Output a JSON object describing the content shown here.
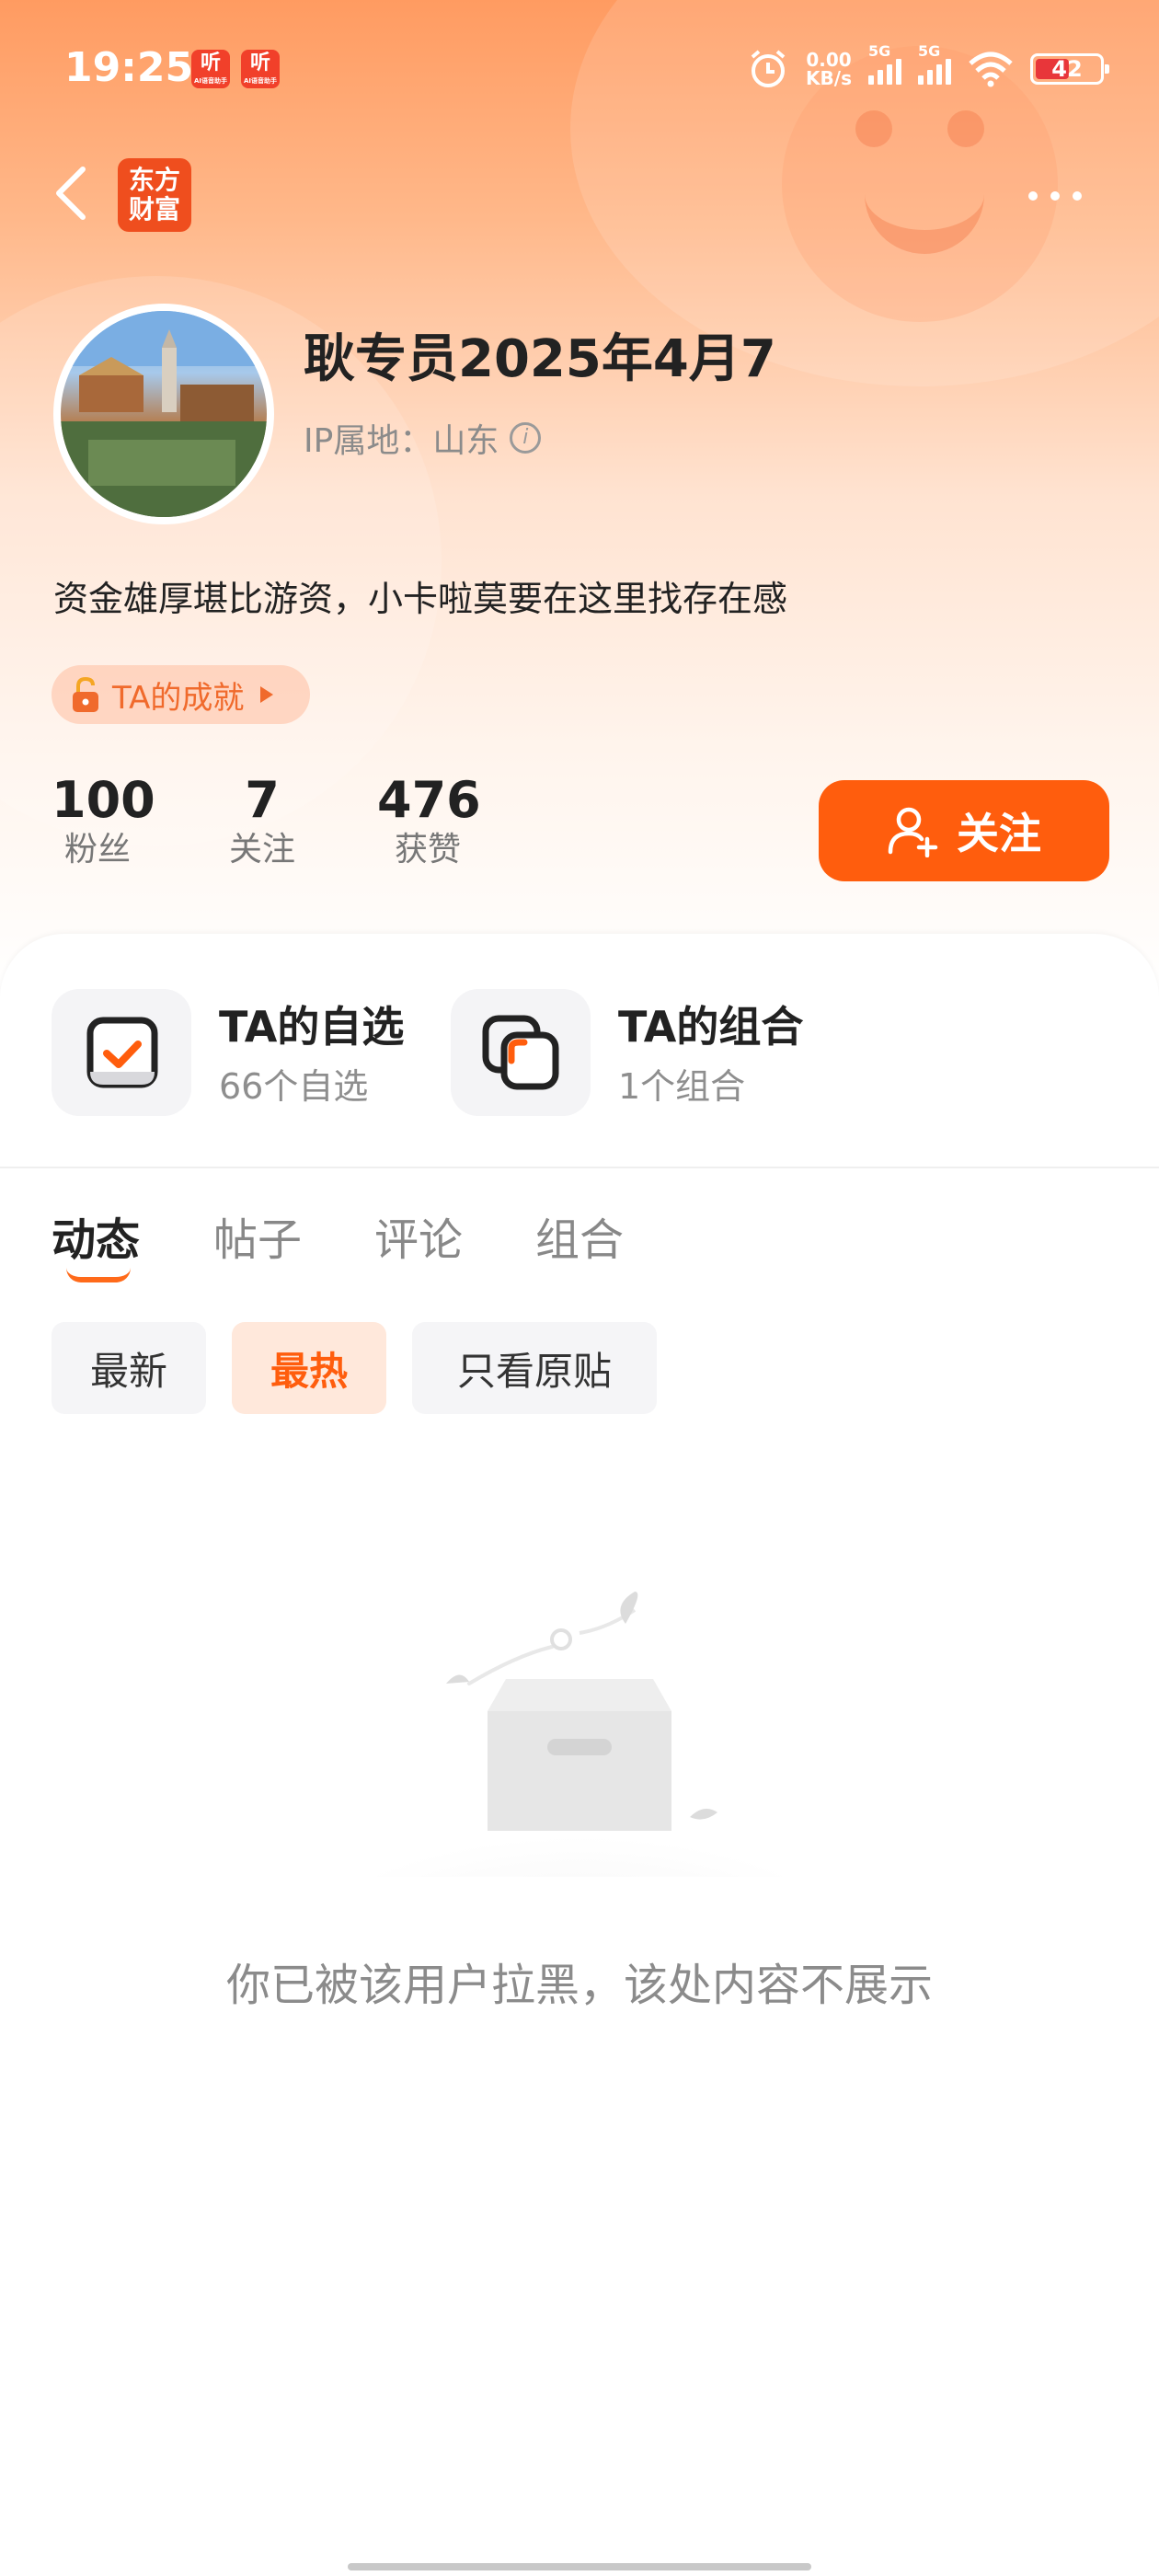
{
  "status_bar": {
    "time": "19:25",
    "app_badges": [
      {
        "glyph": "听",
        "caption": "AI语音助手"
      },
      {
        "glyph": "听",
        "caption": "AI语音助手"
      }
    ],
    "net_speed_value": "0.00",
    "net_speed_unit": "KB/s",
    "signal_1_label": "5G",
    "signal_2_label": "5G",
    "battery_level": "42",
    "battery_color": "#e8363a"
  },
  "nav": {
    "logo_line1": "东方",
    "logo_line2": "财富",
    "logo_color": "#ef4e1e"
  },
  "profile": {
    "username": "耿专员2025年4月7",
    "ip_location": "IP属地：山东",
    "bio": "资金雄厚堪比游资，小卡啦莫要在这里找存在感",
    "achievement": "TA的成就"
  },
  "stats": [
    {
      "value": "100",
      "label": "粉丝"
    },
    {
      "value": "7",
      "label": "关注"
    },
    {
      "value": "476",
      "label": "获赞"
    }
  ],
  "follow_button": {
    "label": "关注",
    "color": "#ff5d0d"
  },
  "shortcuts": [
    {
      "title": "TA的自选",
      "subtitle": "66个自选",
      "icon": "watchlist-check-icon"
    },
    {
      "title": "TA的组合",
      "subtitle": "1个组合",
      "icon": "portfolio-squares-icon"
    }
  ],
  "tabs": [
    {
      "label": "动态",
      "active": true
    },
    {
      "label": "帖子",
      "active": false
    },
    {
      "label": "评论",
      "active": false
    },
    {
      "label": "组合",
      "active": false
    }
  ],
  "filters": [
    {
      "label": "最新",
      "active": false
    },
    {
      "label": "最热",
      "active": true
    },
    {
      "label": "只看原贴",
      "active": false
    }
  ],
  "empty_state": {
    "message": "你已被该用户拉黑，该处内容不展示",
    "icon": "empty-box-icon"
  },
  "accent_color": "#ff5d0d"
}
